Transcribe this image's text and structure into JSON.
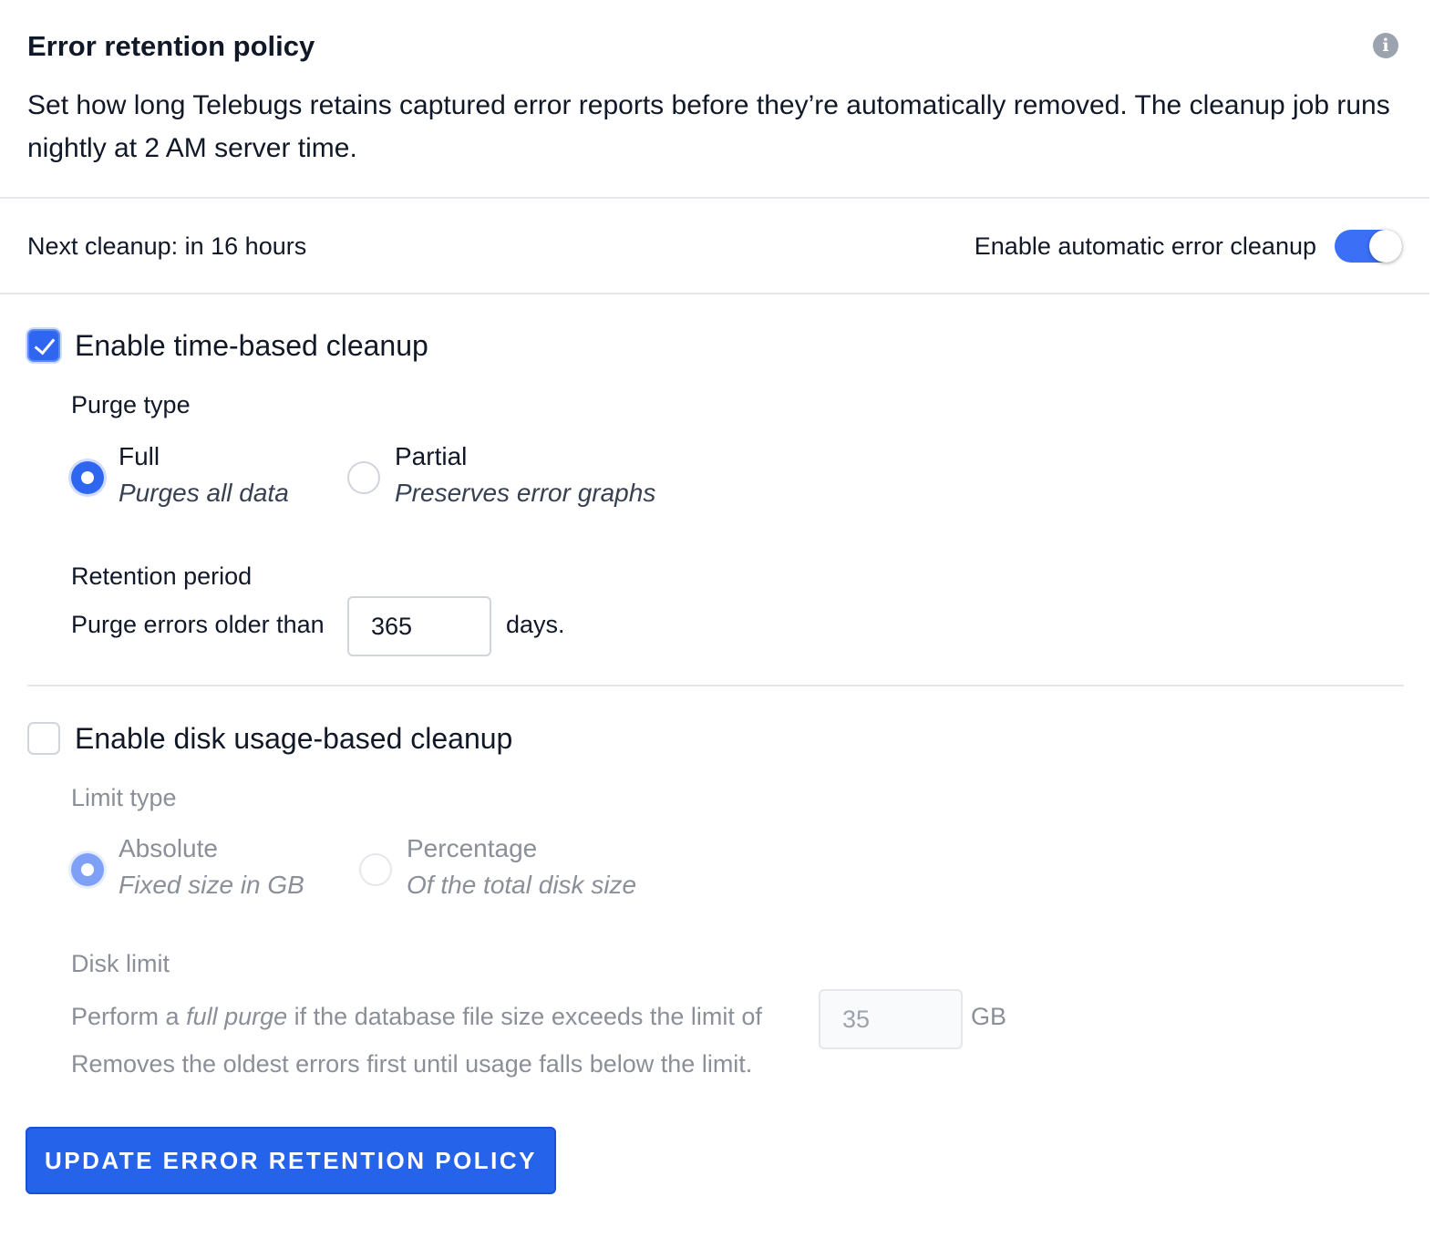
{
  "header": {
    "title": "Error retention policy",
    "description": "Set how long Telebugs retains captured error reports before they’re automatically removed. The cleanup job runs nightly at 2 AM server time.",
    "info_icon": "info-icon"
  },
  "status": {
    "next_cleanup_label": "Next cleanup:",
    "next_cleanup_value": "in 16 hours",
    "auto_cleanup_label": "Enable automatic error cleanup",
    "auto_cleanup_enabled": true
  },
  "time_based": {
    "checkbox_label": "Enable time-based cleanup",
    "checked": true,
    "purge_type_label": "Purge type",
    "options": [
      {
        "title": "Full",
        "subtitle": "Purges all data",
        "selected": true
      },
      {
        "title": "Partial",
        "subtitle": "Preserves error graphs",
        "selected": false
      }
    ],
    "retention_label": "Retention period",
    "retention_prefix": "Purge errors older than",
    "retention_value": "365",
    "retention_suffix": "days."
  },
  "disk_based": {
    "checkbox_label": "Enable disk usage-based cleanup",
    "checked": false,
    "limit_type_label": "Limit type",
    "options": [
      {
        "title": "Absolute",
        "subtitle": "Fixed size in GB",
        "selected": true
      },
      {
        "title": "Percentage",
        "subtitle": "Of the total disk size",
        "selected": false
      }
    ],
    "disk_limit_label": "Disk limit",
    "limit_prefix_1": "Perform a",
    "limit_prefix_em": "full purge",
    "limit_prefix_2": "if the database file size exceeds the limit of",
    "limit_value": "35",
    "limit_unit": "GB",
    "help_text": "Removes the oldest errors first until usage falls below the limit."
  },
  "actions": {
    "submit_label": "UPDATE ERROR RETENTION POLICY"
  },
  "colors": {
    "accent": "#2563eb",
    "divider": "#e5e7eb",
    "disabled_text": "#8a8f98"
  }
}
